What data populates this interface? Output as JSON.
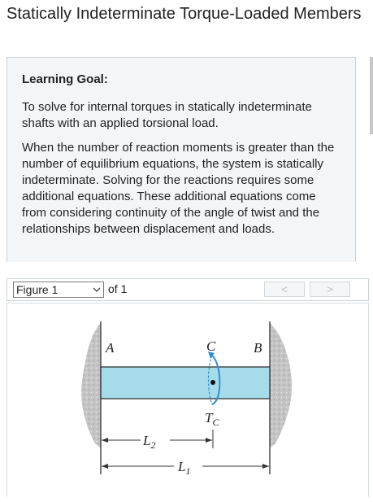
{
  "page": {
    "title": "Statically Indeterminate Torque-Loaded Members"
  },
  "learning_goal": {
    "heading": "Learning Goal:",
    "paragraphs": [
      "To solve for internal torques in statically indeterminate shafts with an applied torsional load.",
      "When the number of reaction moments is greater than the number of equilibrium equations, the system is statically indeterminate. Solving for the reactions requires some additional equations. These additional equations come from considering continuity of the angle of twist and the relationships between displacement and loads."
    ]
  },
  "figure_nav": {
    "selected": "Figure 1",
    "of_label": "of 1",
    "prev_label": "<",
    "next_label": ">"
  },
  "figure": {
    "label_a": "A",
    "label_b": "B",
    "label_c": "C",
    "torque_label": "T",
    "torque_sub": "C",
    "dim_short": "L",
    "dim_short_sub": "2",
    "dim_long": "L",
    "dim_long_sub": "1"
  },
  "colors": {
    "shaft": "#a6dce9",
    "torque": "#2f8fd8",
    "wall": "#bdbdbd",
    "panel_bg": "#f3f6f9"
  }
}
